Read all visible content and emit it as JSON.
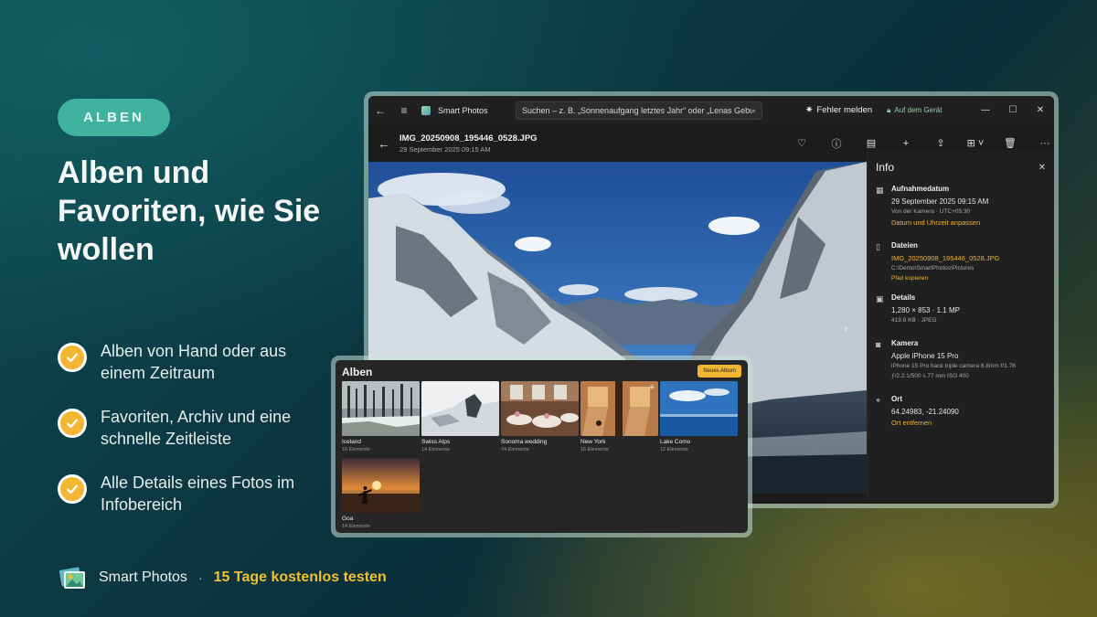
{
  "promo": {
    "badge": "ALBEN",
    "headline": "Alben und Favoriten, wie Sie wollen",
    "features": [
      {
        "text": "Alben von Hand oder aus einem Zeitraum"
      },
      {
        "text": "Favoriten, Archiv und eine schnelle Zeitleiste"
      },
      {
        "text": "Alle Details eines Fotos im Infobereich"
      }
    ],
    "footer": {
      "app_name": "Smart Photos",
      "separator": "·",
      "cta": "15 Tage kostenlos testen"
    }
  },
  "window": {
    "app_title": "Smart Photos",
    "search_placeholder": "Suchen – z. B. „Sonnenaufgang letztes Jahr“ oder „Lenas Geburtstag“",
    "report_label": "Fehler melden",
    "on_device_label": "Auf dem Gerät",
    "file_name": "IMG_20250908_195446_0528.JPG",
    "file_date": "29 September 2025 09:15 AM"
  },
  "info": {
    "title": "Info",
    "capture": {
      "label": "Aufnahmedatum",
      "value": "29 September 2025 09:15 AM",
      "sub": "Von der Kamera · UTC+05:30",
      "link": "Datum und Uhrzeit anpassen"
    },
    "files": {
      "label": "Dateien",
      "value": "IMG_20250908_195446_0528.JPG",
      "path": "C:\\Demo\\SmartPhotos\\Pictures",
      "link": "Pfad kopieren"
    },
    "details": {
      "label": "Details",
      "value": "1,280 × 853 · 1.1 MP",
      "sub": "419.8 KB · JPEG"
    },
    "camera": {
      "label": "Kamera",
      "value": "Apple iPhone 15 Pro",
      "sub": "iPhone 15 Pro back triple camera 6.8mm f/1.78",
      "sub2": "ƒ/2.2   1/500 s   77 mm   ISO 400"
    },
    "location": {
      "label": "Ort",
      "value": "64.24983, -21.24090",
      "link": "Ort entfernen"
    }
  },
  "albums": {
    "title": "Alben",
    "new_album": "Neues Album",
    "items": [
      {
        "name": "Iceland",
        "count": "16 Elemente"
      },
      {
        "name": "Swiss Alps",
        "count": "14 Elemente"
      },
      {
        "name": "Sonoma wedding",
        "count": "74 Elemente"
      },
      {
        "name": "New York",
        "count": "16 Elemente"
      },
      {
        "name": "Lake Como",
        "count": "12 Elemente"
      },
      {
        "name": "Goa",
        "count": "14 Elemente"
      }
    ]
  },
  "colors": {
    "accent": "#f2b632",
    "badge": "#3fb3a0",
    "link": "#e9b43b"
  }
}
